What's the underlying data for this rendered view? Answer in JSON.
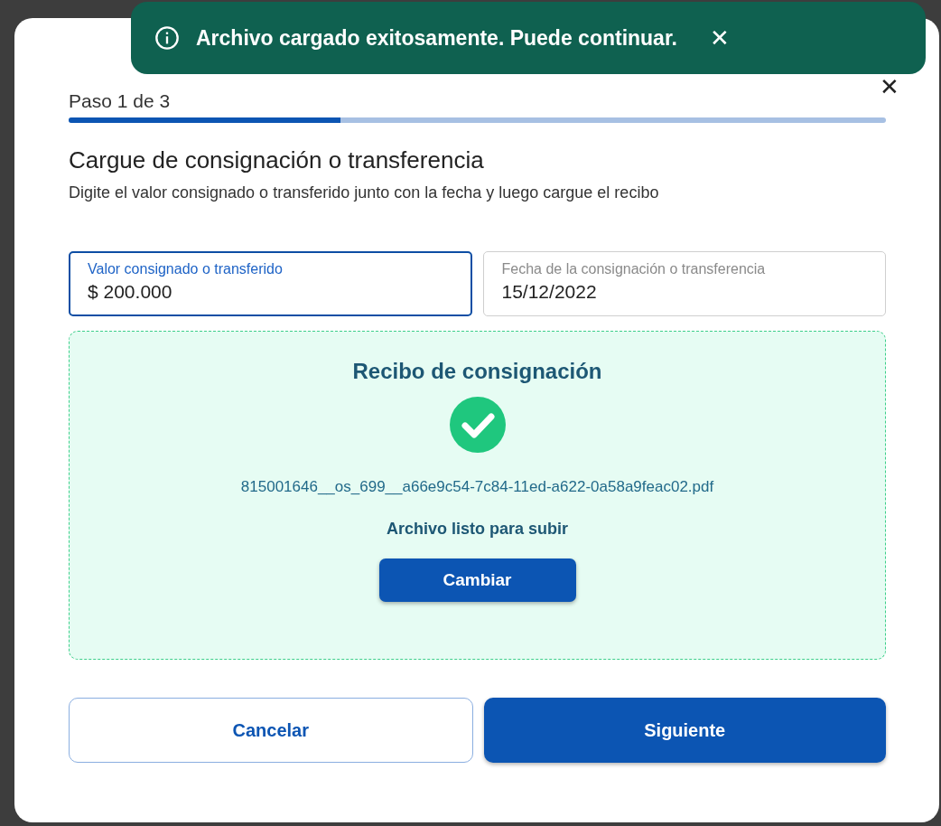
{
  "toast": {
    "message": "Archivo cargado exitosamente. Puede continuar.",
    "close": "✕"
  },
  "dialog": {
    "close": "✕",
    "step": "Paso 1 de 3",
    "progress": {
      "level": 0.333
    },
    "title": "Cargue de consignación o transferencia",
    "subtitle": "Digite el valor consignado o transferido junto con la fecha y luego cargue el recibo",
    "fields": [
      {
        "label": "Valor consignado o transferido",
        "value": "$ 200.000",
        "focused": true
      },
      {
        "label": "Fecha de la consignación o transferencia",
        "value": "15/12/2022",
        "focused": false
      }
    ],
    "upload": {
      "title": "Recibo de consignación",
      "uploaded": true,
      "file_name": "815001646__os_699__a66e9c54-7c84-11ed-a622-0a58a9feac02.pdf",
      "status": "Archivo listo para subir",
      "button": "Cambiar"
    },
    "buttons": [
      {
        "label": "Cancelar",
        "kind": "secondary"
      },
      {
        "label": "Siguiente",
        "kind": "primary"
      }
    ]
  }
}
